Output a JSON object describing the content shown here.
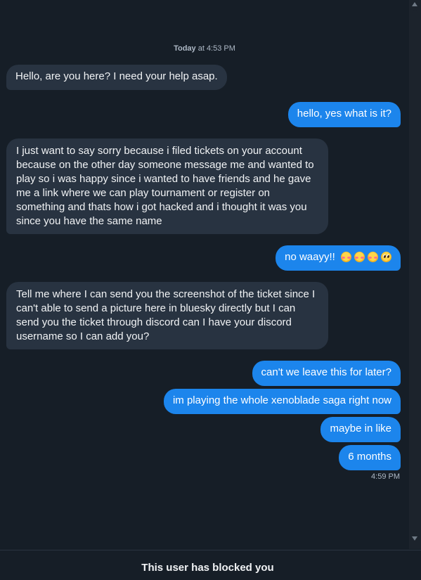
{
  "conversation": {
    "date_separator": {
      "day": "Today",
      "rest": " at 4:53 PM"
    },
    "messages": [
      {
        "from": "them",
        "text": "Hello, are you here? I need your help asap."
      },
      {
        "from": "me",
        "text": "hello, yes what is it?"
      },
      {
        "from": "them",
        "text": "I just want to say sorry because i filed tickets on your account because on the other day someone message me and wanted to play so i was happy since i wanted to have friends and he gave me a link where we can play tournament or register on something and thats how i got hacked and i thought it was you since you have the same name"
      },
      {
        "from": "me",
        "text": "no waayy!!",
        "emojis": [
          "flushed-face-emoji",
          "flushed-face-emoji",
          "flushed-face-emoji",
          "pleading-face-emoji"
        ]
      },
      {
        "from": "them",
        "text": "Tell me where I can send you the screenshot of the ticket since I can't able to send a picture here in bluesky directly but I can send you the ticket through discord can I have your discord username so I can add you?"
      },
      {
        "from": "me",
        "text": "can't we leave this for later?"
      },
      {
        "from": "me",
        "text": "im playing the whole xenoblade saga right now"
      },
      {
        "from": "me",
        "text": "maybe in like"
      },
      {
        "from": "me",
        "text": "6 months"
      }
    ],
    "last_message_time": "4:59 PM"
  },
  "footer": {
    "blocked_notice": "This user has blocked you"
  },
  "colors": {
    "background": "#161e27",
    "incoming_bubble": "#283341",
    "outgoing_bubble": "#1c85ec",
    "muted_text": "#aeb9c6"
  }
}
